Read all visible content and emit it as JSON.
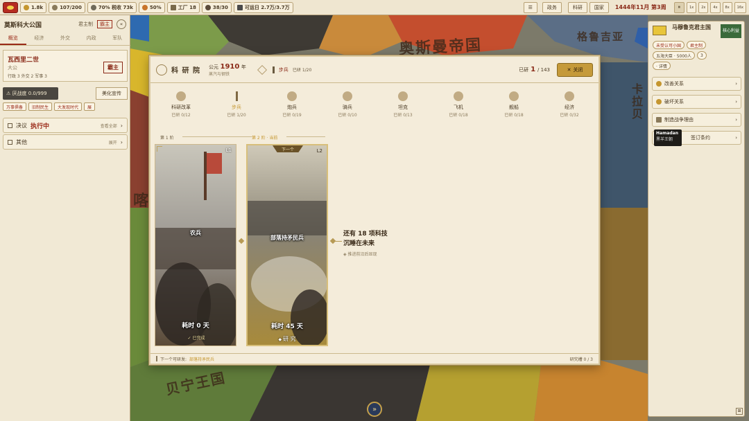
{
  "topbar": {
    "resources": [
      {
        "icon": "gold-coin-icon",
        "value": "1.8k"
      },
      {
        "icon": "manpower-icon",
        "value": "107/200"
      },
      {
        "icon": "tax-icon",
        "value": "70% 税收 73k"
      },
      {
        "icon": "stability-icon",
        "value": "50%"
      },
      {
        "icon": "factory-icon",
        "value": "工厂 18"
      },
      {
        "icon": "unit-icon",
        "value": "38/30"
      },
      {
        "icon": "transport-icon",
        "value": "可运日 2.7万/3.7万"
      }
    ],
    "buttons": [
      "☰",
      "政务",
      "科研",
      "国家"
    ],
    "date": "1444年11月 第3周",
    "pause": "⏸",
    "speeds": [
      "1x",
      "2x",
      "4x",
      "8x",
      "16x"
    ]
  },
  "map": {
    "labels": [
      "奥斯曼帝国",
      "格鲁吉亚",
      "贝宁王国",
      "喀",
      "卡拉贝",
      "莫斯科大公国"
    ]
  },
  "left_panel": {
    "country": "莫斯科大公国",
    "government": "君主制",
    "rank_badge": "霸主",
    "tabs": [
      "概览",
      "经济",
      "外交",
      "内政",
      "军队"
    ],
    "ruler_name": "瓦西里二世",
    "ruler_title": "大公",
    "ruler_stats": "行政 3  外交 2  军事 3",
    "ruler_badge": "霸主",
    "warning": "⚠ 厌战度 0.0/999",
    "propaganda_btn": "美化宣传",
    "modifiers": [
      "万事俱备",
      "旧制民生",
      "大发现时代",
      "展"
    ],
    "decision_label": "决议",
    "decision_status": "执行中",
    "decision_link": "查看全部",
    "other_label": "其他",
    "other_link": "展开"
  },
  "right_panel": {
    "country": "马穆鲁克君主国",
    "core_badge": "核心利益",
    "tags": [
      "未受认可小国",
      "君主制"
    ],
    "stats": [
      "五海大臣 · 5000人",
      "3"
    ],
    "detail": "· 详情",
    "actions": [
      "改善关系",
      "破坏关系",
      "制造战争理由",
      "签订条约"
    ],
    "tooltip_title": "Hamadan",
    "tooltip_sub": "黑羊王朝"
  },
  "modal": {
    "title": "科 研 院",
    "era_prefix": "公元",
    "era_year": "1910",
    "era_suffix": "年",
    "era_name": "蒸汽与钢铁",
    "current_cat": "步兵",
    "current_progress": "已研 1/20",
    "total_label": "已研",
    "total_done": "1",
    "total_all": "/ 143",
    "close_label": "关闭",
    "categories": [
      {
        "name": "科研改革",
        "progress": "已研 0/12"
      },
      {
        "name": "步兵",
        "progress": "已研 1/20"
      },
      {
        "name": "炮兵",
        "progress": "已研 0/19"
      },
      {
        "name": "骑兵",
        "progress": "已研 0/10"
      },
      {
        "name": "坦克",
        "progress": "已研 0/13"
      },
      {
        "name": "飞机",
        "progress": "已研 0/18"
      },
      {
        "name": "舰船",
        "progress": "已研 0/18"
      },
      {
        "name": "经济",
        "progress": "已研 0/32"
      }
    ],
    "stage1": "第 1 阶",
    "stage2": "第 2 阶 · 当前",
    "card1": {
      "level": "L1",
      "name": "农兵",
      "cost": "耗时 0 天",
      "status": "✓ 已完成"
    },
    "card2": {
      "level": "L2",
      "name": "部落持矛民兵",
      "cost": "耗时 45 天",
      "tag": "下一个",
      "action": "研 究"
    },
    "remaining_line1": "还有 18 项科技",
    "remaining_line2": "沉睡在未来",
    "remaining_hint": "◈ 推进前沿后显现",
    "footer_prefix": "下一个可研发:",
    "footer_next": "部落持矛民兵",
    "footer_right": "研究槽 0 / 3"
  },
  "bottom_button": "»"
}
